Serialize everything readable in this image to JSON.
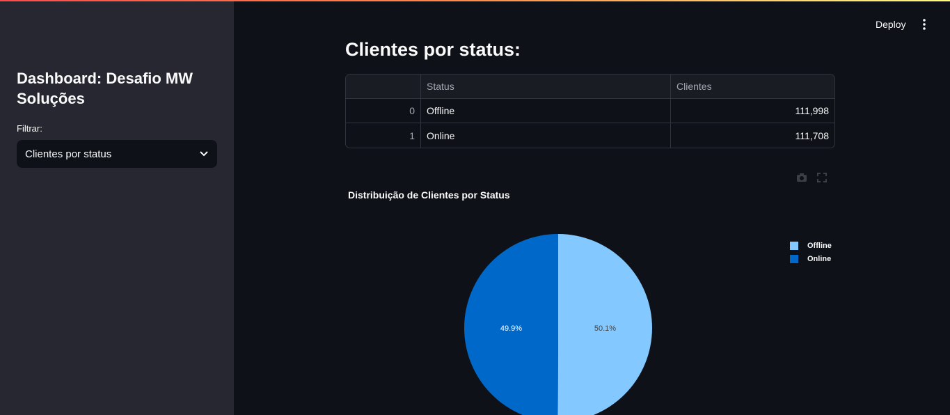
{
  "sidebar": {
    "title": "Dashboard: Desafio MW Soluções",
    "filter_label": "Filtrar:",
    "filter_value": "Clientes por status"
  },
  "header": {
    "deploy_label": "Deploy",
    "menu_icon": "vertical-dots-icon"
  },
  "main": {
    "page_title": "Clientes por status:",
    "table": {
      "columns": [
        "",
        "Status",
        "Clientes"
      ],
      "rows": [
        {
          "index": "0",
          "status": "Offline",
          "clientes": "111,998"
        },
        {
          "index": "1",
          "status": "Online",
          "clientes": "111,708"
        }
      ]
    },
    "toolbar_icons": [
      "camera-icon",
      "fullscreen-icon"
    ]
  },
  "colors": {
    "offline": "#83c9ff",
    "online": "#0068c9",
    "background": "#0e1117",
    "sidebar": "#262730"
  },
  "chart_data": {
    "type": "pie",
    "title": "Distribuição de Clientes por Status",
    "categories": [
      "Offline",
      "Online"
    ],
    "values": [
      111998,
      111708
    ],
    "labels": [
      "50.1%",
      "49.9%"
    ],
    "colors": [
      "#83c9ff",
      "#0068c9"
    ],
    "legend": "top-right"
  }
}
